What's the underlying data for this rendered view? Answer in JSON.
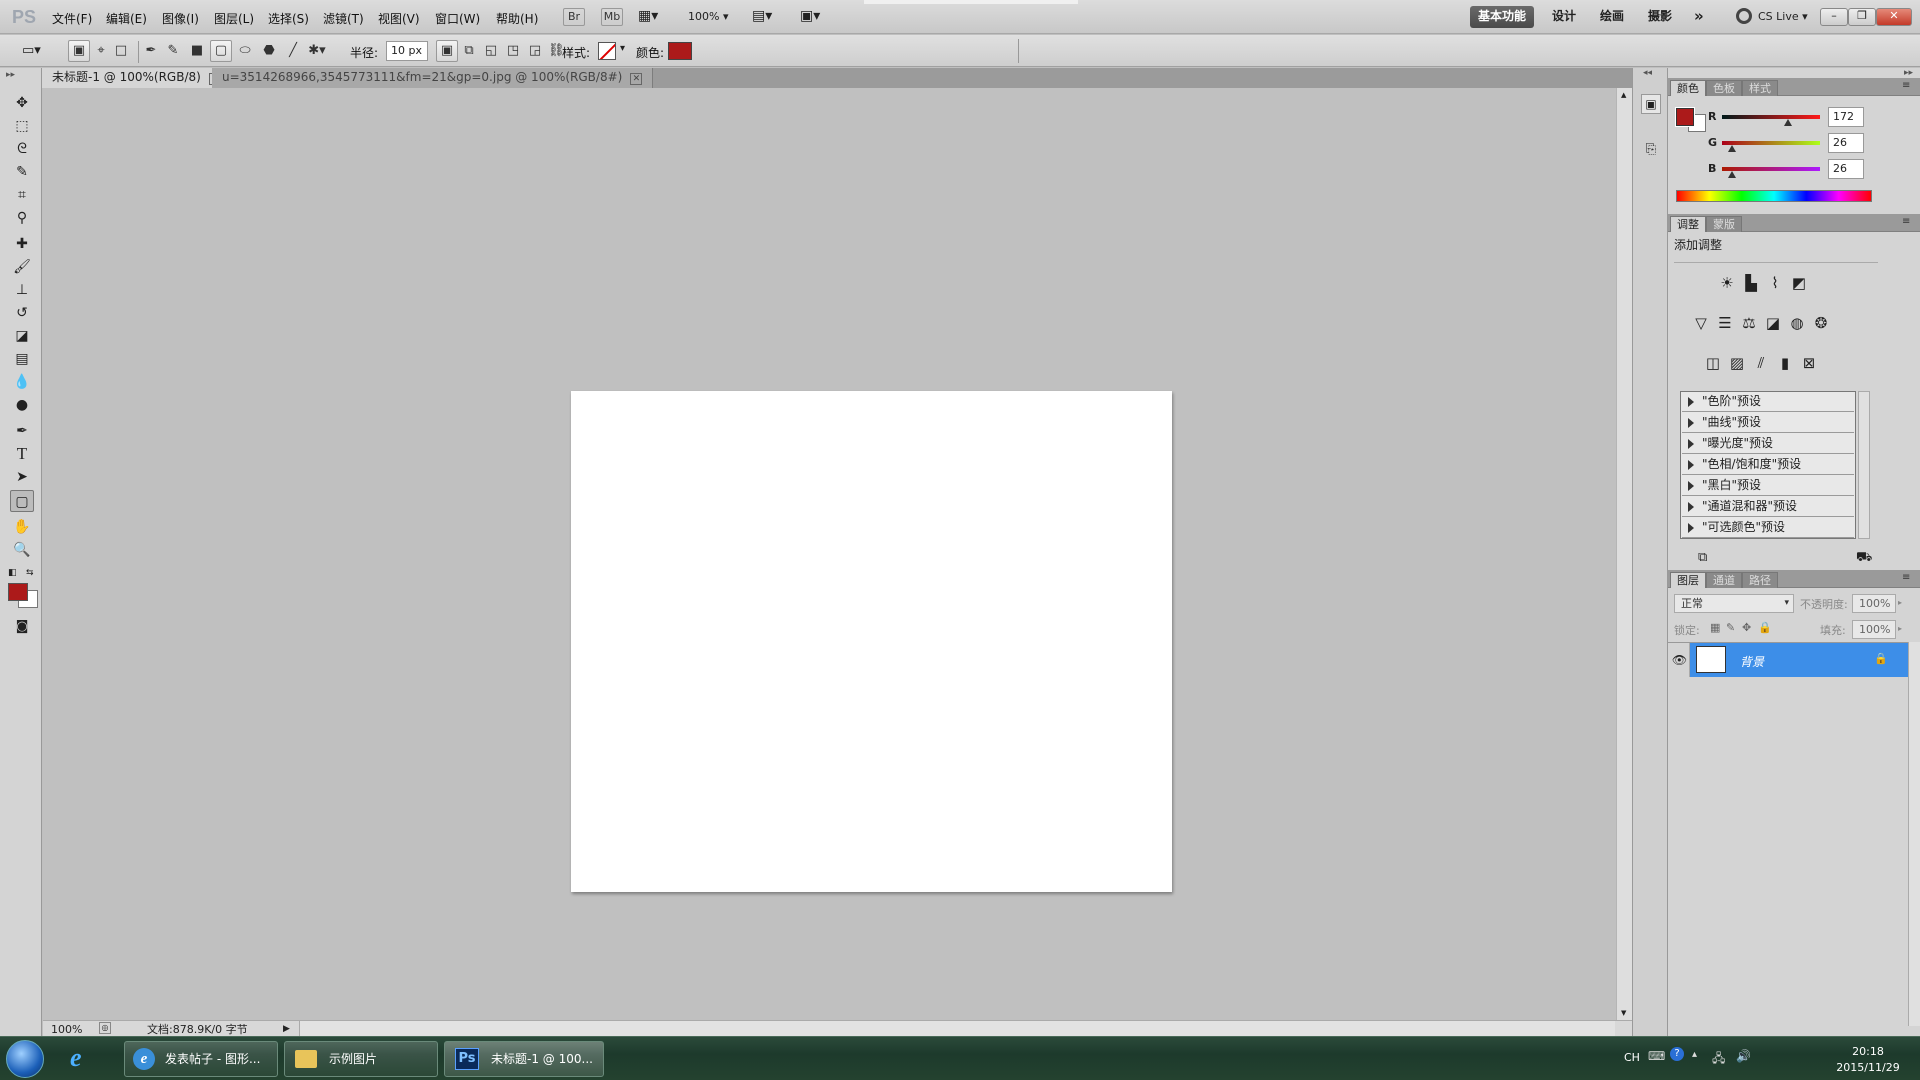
{
  "app": {
    "logo": "PS"
  },
  "menu": [
    "文件(F)",
    "编辑(E)",
    "图像(I)",
    "图层(L)",
    "选择(S)",
    "滤镜(T)",
    "视图(V)",
    "窗口(W)",
    "帮助(H)"
  ],
  "menubar_tools": {
    "br": "Br",
    "mb": "Mb",
    "zoom": "100%"
  },
  "workspaces": {
    "active": "基本功能",
    "items": [
      "设计",
      "绘画",
      "摄影"
    ],
    "more": "»",
    "cslive": "CS Live"
  },
  "options": {
    "radius_label": "半径:",
    "radius_value": "10 px",
    "style_label": "样式:",
    "color_label": "颜色:"
  },
  "tabs": [
    {
      "label": "未标题-1 @ 100%(RGB/8)"
    },
    {
      "label": "u=3514268966,3545773111&fm=21&gp=0.jpg @ 100%(RGB/8#)"
    }
  ],
  "status": {
    "zoom": "100%",
    "doc": "文档:878.9K/0 字节"
  },
  "color_panel": {
    "tabs": [
      "颜色",
      "色板",
      "样式"
    ],
    "r_label": "R",
    "g_label": "G",
    "b_label": "B",
    "r": "172",
    "g": "26",
    "b": "26",
    "r_level": 0.675,
    "g_level": 0.102,
    "b_level": 0.102,
    "foreground": "#ac1a1a"
  },
  "adjust_panel": {
    "tabs": [
      "调整",
      "蒙版"
    ],
    "title": "添加调整",
    "presets": [
      "\"色阶\"预设",
      "\"曲线\"预设",
      "\"曝光度\"预设",
      "\"色相/饱和度\"预设",
      "\"黑白\"预设",
      "\"通道混和器\"预设",
      "\"可选颜色\"预设"
    ]
  },
  "layers_panel": {
    "tabs": [
      "图层",
      "通道",
      "路径"
    ],
    "blend_mode": "正常",
    "opacity_label": "不透明度:",
    "opacity": "100%",
    "lock_label": "锁定:",
    "fill_label": "填充:",
    "fill": "100%",
    "layers": [
      {
        "name": "背景"
      }
    ]
  },
  "taskbar": {
    "items": [
      "发表帖子 - 图形...",
      "示例图片",
      "未标题-1 @ 100..."
    ],
    "ps_icon": "Ps",
    "lang": "CH",
    "time": "20:18",
    "date": "2015/11/29"
  },
  "icons": [
    "start-orb-icon",
    "ie-icon",
    "folder-icon",
    "photoshop-icon",
    "eye-icon",
    "lock-icon",
    "move-tool-icon",
    "rectangle-tool-icon"
  ],
  "colors": {
    "accent_blue": "#3d8ee8",
    "foreground_swatch": "#ac1a1a"
  }
}
